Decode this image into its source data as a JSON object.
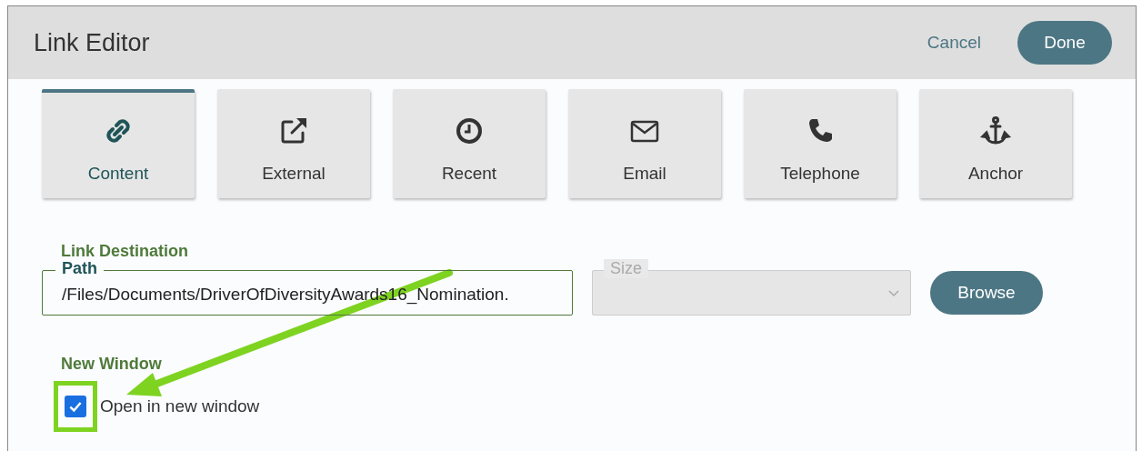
{
  "window": {
    "title": "Link Editor"
  },
  "actions": {
    "cancel": "Cancel",
    "done": "Done"
  },
  "tabs": [
    {
      "label": "Content",
      "selected": true
    },
    {
      "label": "External",
      "selected": false
    },
    {
      "label": "Recent",
      "selected": false
    },
    {
      "label": "Email",
      "selected": false
    },
    {
      "label": "Telephone",
      "selected": false
    },
    {
      "label": "Anchor",
      "selected": false
    }
  ],
  "link_destination": {
    "heading": "Link Destination",
    "path": {
      "label": "Path",
      "value": "/Files/Documents/DriverOfDiversityAwards16_Nomination."
    },
    "size": {
      "label": "Size",
      "disabled": true
    },
    "browse": "Browse"
  },
  "new_window": {
    "heading": "New Window",
    "checkbox": {
      "label": "Open in new window",
      "checked": true
    }
  }
}
